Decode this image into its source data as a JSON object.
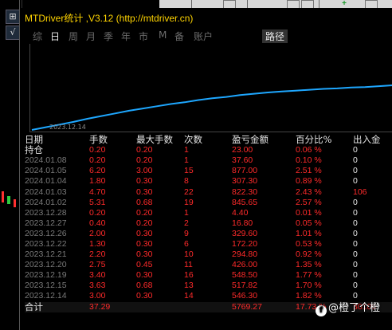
{
  "window": {
    "title": "MTDriver统计 ,V3.12 (http://mtdriver.cn)"
  },
  "left_strip": {
    "buttons": [
      {
        "label": "⊞",
        "icon": "grid-icon"
      },
      {
        "label": "√",
        "icon": "check-icon"
      }
    ]
  },
  "tabs": [
    {
      "label": "综",
      "active": false
    },
    {
      "label": "日",
      "active": true
    },
    {
      "label": "周",
      "active": false
    },
    {
      "label": "月",
      "active": false
    },
    {
      "label": "季",
      "active": false
    },
    {
      "label": "年",
      "active": false
    },
    {
      "label": "市",
      "active": false
    },
    {
      "label": "M",
      "active": false
    },
    {
      "label": "备",
      "active": false
    },
    {
      "label": "账户",
      "active": false
    },
    {
      "label": "路径",
      "active": false
    }
  ],
  "chart_data": {
    "type": "line",
    "x_label_start": "2023.12.14",
    "line_color": "#1ea7ff",
    "series": [
      {
        "values": [
          0,
          0.06,
          0.12,
          0.18,
          0.25,
          0.31,
          0.37,
          0.43,
          0.48,
          0.53,
          0.58,
          0.62,
          0.67,
          0.71,
          0.74,
          0.78,
          0.81,
          0.84,
          0.86,
          0.88,
          0.9,
          0.92,
          0.93,
          0.95,
          0.96,
          0.98,
          1.0
        ]
      }
    ]
  },
  "table": {
    "headers": [
      "日期",
      "手数",
      "最大手数",
      "次数",
      "盈亏金额",
      "百分比%",
      "出入金"
    ],
    "rows": [
      {
        "date": "持仓",
        "lots": "0.20",
        "max_lots": "0.20",
        "count": "1",
        "pnl": "23.00",
        "pct": "0.06 %",
        "flow": "0"
      },
      {
        "date": "2024.01.08",
        "lots": "0.20",
        "max_lots": "0.20",
        "count": "1",
        "pnl": "37.60",
        "pct": "0.10 %",
        "flow": "0"
      },
      {
        "date": "2024.01.05",
        "lots": "6.20",
        "max_lots": "3.00",
        "count": "15",
        "pnl": "877.00",
        "pct": "2.51 %",
        "flow": "0"
      },
      {
        "date": "2024.01.04",
        "lots": "1.80",
        "max_lots": "0.30",
        "count": "8",
        "pnl": "307.30",
        "pct": "0.89 %",
        "flow": "0"
      },
      {
        "date": "2024.01.03",
        "lots": "4.70",
        "max_lots": "0.30",
        "count": "22",
        "pnl": "822.30",
        "pct": "2.43 %",
        "flow": "106"
      },
      {
        "date": "2024.01.02",
        "lots": "5.31",
        "max_lots": "0.68",
        "count": "19",
        "pnl": "845.65",
        "pct": "2.57 %",
        "flow": "0"
      },
      {
        "date": "2023.12.28",
        "lots": "0.20",
        "max_lots": "0.20",
        "count": "1",
        "pnl": "4.40",
        "pct": "0.01 %",
        "flow": "0"
      },
      {
        "date": "2023.12.27",
        "lots": "0.40",
        "max_lots": "0.20",
        "count": "2",
        "pnl": "16.80",
        "pct": "0.05 %",
        "flow": "0"
      },
      {
        "date": "2023.12.26",
        "lots": "2.00",
        "max_lots": "0.30",
        "count": "9",
        "pnl": "329.60",
        "pct": "1.01 %",
        "flow": "0"
      },
      {
        "date": "2023.12.22",
        "lots": "1.30",
        "max_lots": "0.30",
        "count": "6",
        "pnl": "172.20",
        "pct": "0.53 %",
        "flow": "0"
      },
      {
        "date": "2023.12.21",
        "lots": "2.20",
        "max_lots": "0.30",
        "count": "10",
        "pnl": "294.80",
        "pct": "0.92 %",
        "flow": "0"
      },
      {
        "date": "2023.12.20",
        "lots": "2.75",
        "max_lots": "0.45",
        "count": "11",
        "pnl": "426.00",
        "pct": "1.35 %",
        "flow": "0"
      },
      {
        "date": "2023.12.19",
        "lots": "3.40",
        "max_lots": "0.30",
        "count": "16",
        "pnl": "548.50",
        "pct": "1.77 %",
        "flow": "0"
      },
      {
        "date": "2023.12.15",
        "lots": "3.63",
        "max_lots": "0.68",
        "count": "13",
        "pnl": "517.82",
        "pct": "1.70 %",
        "flow": "0"
      },
      {
        "date": "2023.12.14",
        "lots": "3.00",
        "max_lots": "0.30",
        "count": "14",
        "pnl": "546.30",
        "pct": "1.82 %",
        "flow": "0"
      }
    ],
    "total": {
      "label": "合计",
      "lots": "37.29",
      "max_lots": "",
      "count": "",
      "pnl": "5769.27",
      "pct": "17.73 %",
      "flow": "30106"
    }
  },
  "colors": {
    "title": "#ffd400",
    "value_red": "#ff2a2a",
    "line": "#1ea7ff"
  },
  "watermark": {
    "text": "@橙了个橙",
    "logo": "f"
  }
}
